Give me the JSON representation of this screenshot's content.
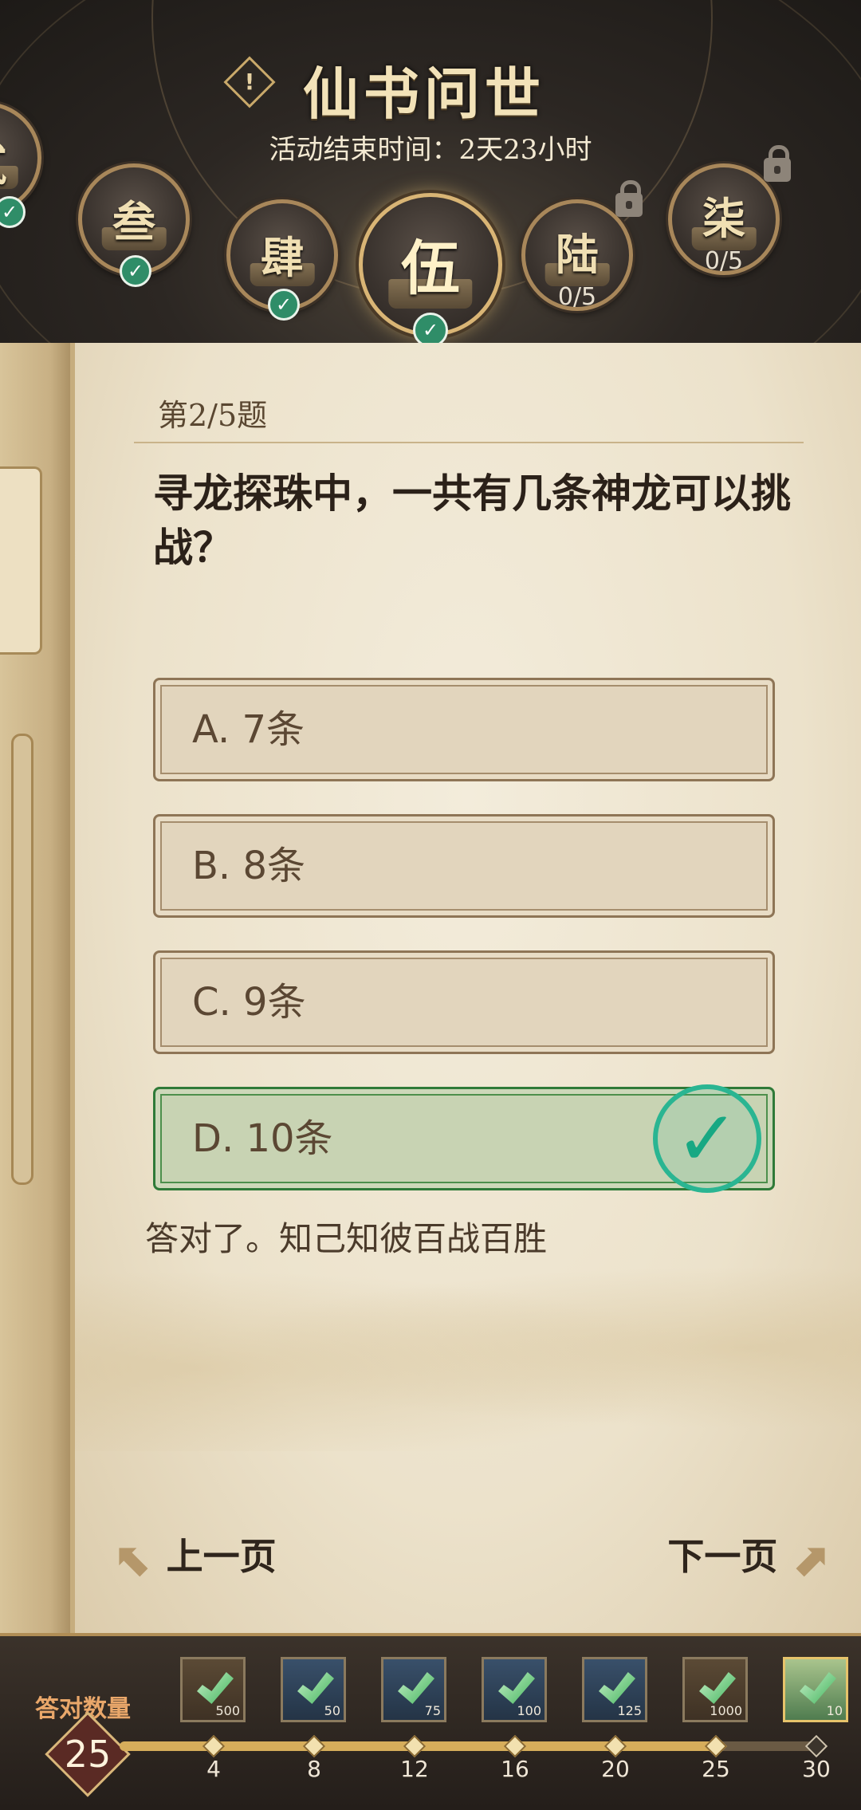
{
  "header": {
    "info_icon": "!",
    "title": "仙书问世",
    "timer": "活动结束时间：2天23小时",
    "chapters": [
      {
        "label": "贰",
        "state": "done"
      },
      {
        "label": "叁",
        "state": "done"
      },
      {
        "label": "肆",
        "state": "done"
      },
      {
        "label": "伍",
        "state": "current"
      },
      {
        "label": "陆",
        "state": "locked",
        "progress": "0/5"
      },
      {
        "label": "柒",
        "state": "locked",
        "progress": "0/5"
      }
    ]
  },
  "quiz": {
    "question_no": "第2/5题",
    "question": "寻龙探珠中，一共有几条神龙可以挑战？",
    "options": [
      {
        "label": "A. 7条",
        "correct": false
      },
      {
        "label": "B. 8条",
        "correct": false
      },
      {
        "label": "C. 9条",
        "correct": false
      },
      {
        "label": "D. 10条",
        "correct": true
      }
    ],
    "feedback": "答对了。知己知彼百战百胜",
    "prev": "上一页",
    "next": "下一页"
  },
  "progress": {
    "label": "答对数量",
    "count": "25",
    "milestones": [
      {
        "value": "4",
        "reward_qty": "500",
        "reached": true,
        "kind": "bronze"
      },
      {
        "value": "8",
        "reward_qty": "50",
        "reached": true,
        "kind": "blue"
      },
      {
        "value": "12",
        "reward_qty": "75",
        "reached": true,
        "kind": "blue"
      },
      {
        "value": "16",
        "reward_qty": "100",
        "reached": true,
        "kind": "blue"
      },
      {
        "value": "20",
        "reward_qty": "125",
        "reached": true,
        "kind": "blue"
      },
      {
        "value": "25",
        "reward_qty": "1000",
        "reached": true,
        "kind": "bronze"
      },
      {
        "value": "30",
        "reward_qty": "10",
        "reached": false,
        "kind": "gold"
      }
    ]
  },
  "colors": {
    "accent_gold": "#d6ad5b",
    "correct_green": "#2ab592",
    "paper": "#ece2cb"
  }
}
